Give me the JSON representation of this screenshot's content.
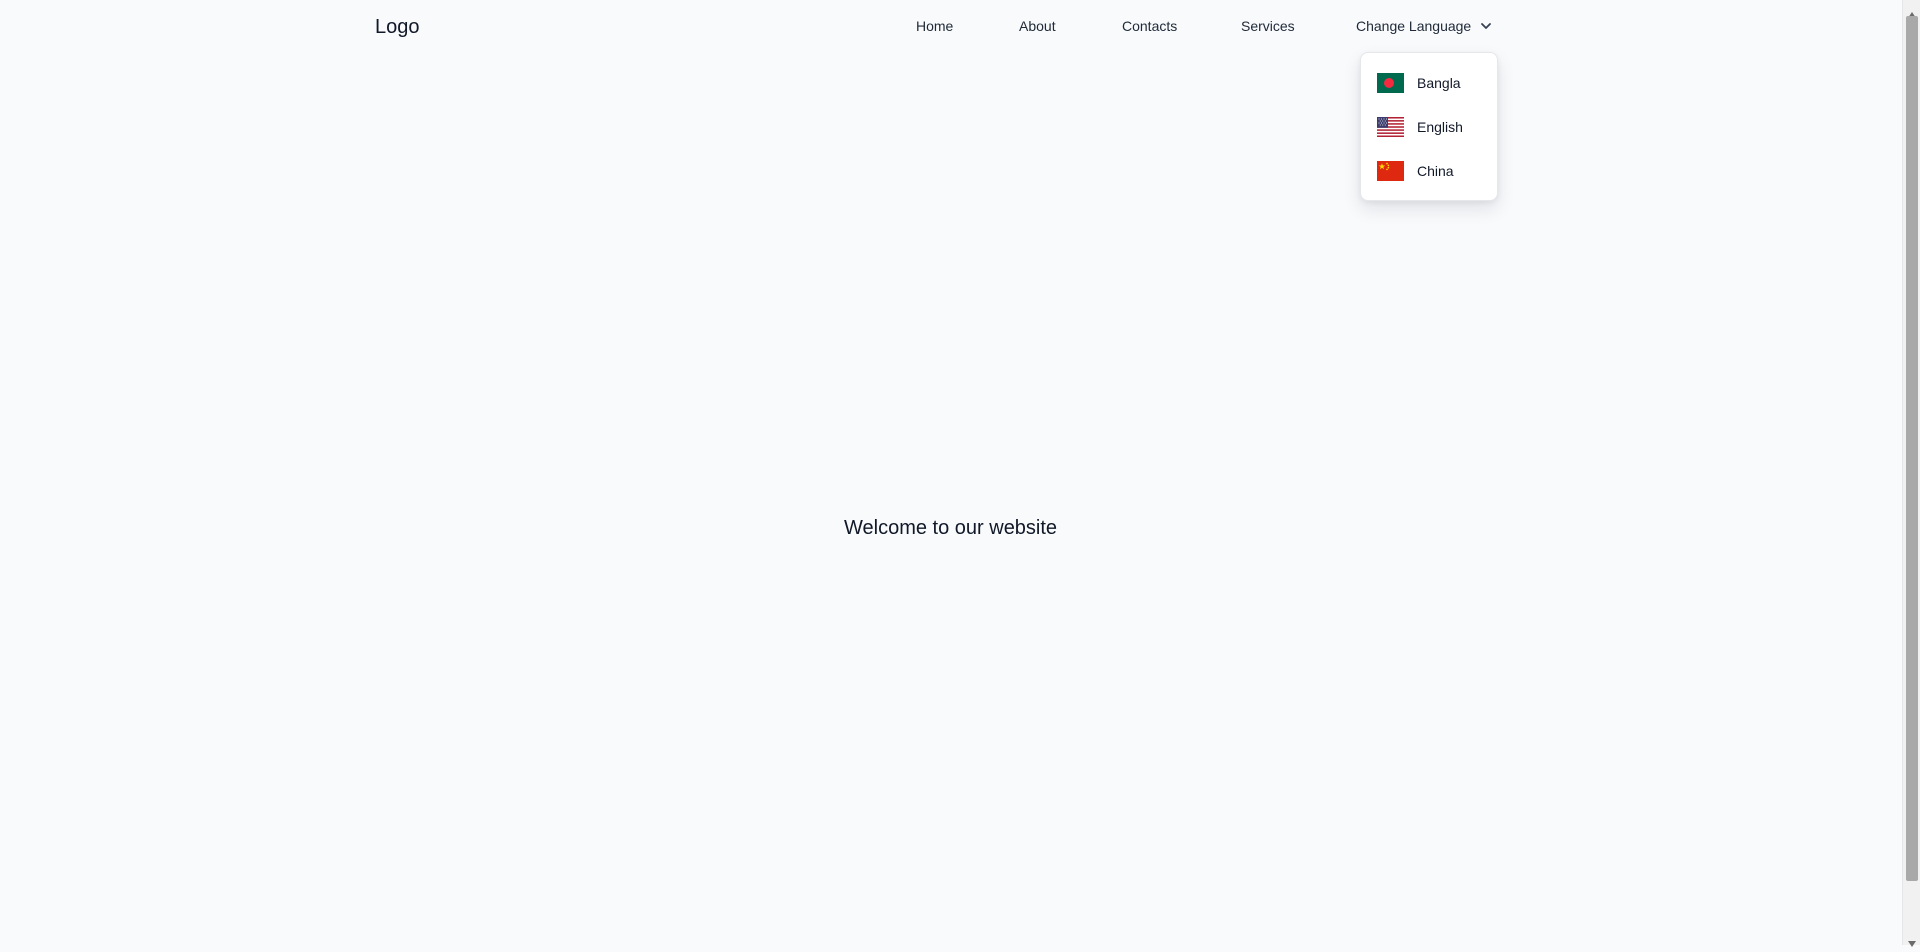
{
  "brand": {
    "logo": "Logo"
  },
  "nav": {
    "home": "Home",
    "about": "About",
    "contacts": "Contacts",
    "services": "Services",
    "change_language": "Change Language"
  },
  "language_menu": {
    "items": [
      {
        "label": "Bangla",
        "icon": "bangladesh-flag-icon",
        "colors": [
          "#006a4e",
          "#f42a41"
        ]
      },
      {
        "label": "English",
        "icon": "us-flag-icon",
        "colors": [
          "#3c3b6e",
          "#ffffff",
          "#b22234"
        ]
      },
      {
        "label": "China",
        "icon": "china-flag-icon",
        "colors": [
          "#de2910",
          "#ffde00"
        ]
      }
    ]
  },
  "main": {
    "welcome": "Welcome to our website"
  },
  "scrollbar": {
    "icons": [
      "scroll-up-arrow-icon",
      "scroll-down-arrow-icon"
    ]
  },
  "theme": {
    "background": "#f8fafc",
    "text": "#1f2937",
    "dropdown_background": "#ffffff",
    "scrollbar_thumb": "#a9a9a9"
  }
}
